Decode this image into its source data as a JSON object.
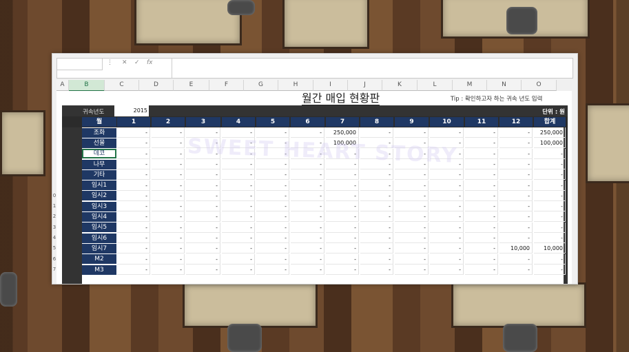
{
  "spreadsheet": {
    "columns": [
      "A",
      "B",
      "C",
      "D",
      "E",
      "F",
      "G",
      "H",
      "I",
      "J",
      "K",
      "L",
      "M",
      "N",
      "O"
    ],
    "selected_column": "B",
    "row_numbers": [
      "0",
      "1",
      "2",
      "3",
      "4",
      "5",
      "6",
      "7"
    ],
    "title": "월간 매입 현황판",
    "tip": "Tip : 확인하고자 하는 귀속 년도 입력",
    "year_label": "귀속년도",
    "year_value": "2015",
    "unit": "단위 : 원",
    "header": [
      "월",
      "1",
      "2",
      "3",
      "4",
      "5",
      "6",
      "7",
      "8",
      "9",
      "10",
      "11",
      "12",
      "합계"
    ],
    "rows": [
      {
        "label": "조화",
        "values": [
          "-",
          "-",
          "-",
          "-",
          "-",
          "-",
          "250,000",
          "-",
          "-",
          "-",
          "-",
          "-",
          "250,000"
        ]
      },
      {
        "label": "선물",
        "values": [
          "-",
          "-",
          "-",
          "-",
          "-",
          "-",
          "100,000",
          "-",
          "-",
          "-",
          "-",
          "-",
          "100,000"
        ]
      },
      {
        "label": "데코",
        "values": [
          "-",
          "-",
          "-",
          "-",
          "-",
          "-",
          "-",
          "-",
          "-",
          "-",
          "-",
          "-",
          "-"
        ]
      },
      {
        "label": "나무",
        "values": [
          "-",
          "-",
          "-",
          "-",
          "-",
          "-",
          "-",
          "-",
          "-",
          "-",
          "-",
          "-",
          "-"
        ]
      },
      {
        "label": "기타",
        "values": [
          "-",
          "-",
          "-",
          "-",
          "-",
          "-",
          "-",
          "-",
          "-",
          "-",
          "-",
          "-",
          "-"
        ]
      },
      {
        "label": "임시1",
        "values": [
          "-",
          "-",
          "-",
          "-",
          "-",
          "-",
          "-",
          "-",
          "-",
          "-",
          "-",
          "-",
          "-"
        ]
      },
      {
        "label": "임시2",
        "values": [
          "-",
          "-",
          "-",
          "-",
          "-",
          "-",
          "-",
          "-",
          "-",
          "-",
          "-",
          "-",
          "-"
        ]
      },
      {
        "label": "임시3",
        "values": [
          "-",
          "-",
          "-",
          "-",
          "-",
          "-",
          "-",
          "-",
          "-",
          "-",
          "-",
          "-",
          "-"
        ]
      },
      {
        "label": "임시4",
        "values": [
          "-",
          "-",
          "-",
          "-",
          "-",
          "-",
          "-",
          "-",
          "-",
          "-",
          "-",
          "-",
          "-"
        ]
      },
      {
        "label": "임시5",
        "values": [
          "-",
          "-",
          "-",
          "-",
          "-",
          "-",
          "-",
          "-",
          "-",
          "-",
          "-",
          "-",
          "-"
        ]
      },
      {
        "label": "임시6",
        "values": [
          "-",
          "-",
          "-",
          "-",
          "-",
          "-",
          "-",
          "-",
          "-",
          "-",
          "-",
          "-",
          "-"
        ]
      },
      {
        "label": "임시7",
        "values": [
          "-",
          "-",
          "-",
          "-",
          "-",
          "-",
          "-",
          "-",
          "-",
          "-",
          "-",
          "10,000",
          "10,000"
        ]
      },
      {
        "label": "M2",
        "values": [
          "-",
          "-",
          "-",
          "-",
          "-",
          "-",
          "-",
          "-",
          "-",
          "-",
          "-",
          "-",
          "-"
        ]
      },
      {
        "label": "M3",
        "values": [
          "-",
          "-",
          "-",
          "-",
          "-",
          "-",
          "-",
          "-",
          "-",
          "-",
          "-",
          "-",
          "-"
        ]
      }
    ],
    "active_row_label": "데코",
    "watermark": "SWEET HEART STORY",
    "header_color": "#1f3864",
    "accent_color": "#217346"
  }
}
